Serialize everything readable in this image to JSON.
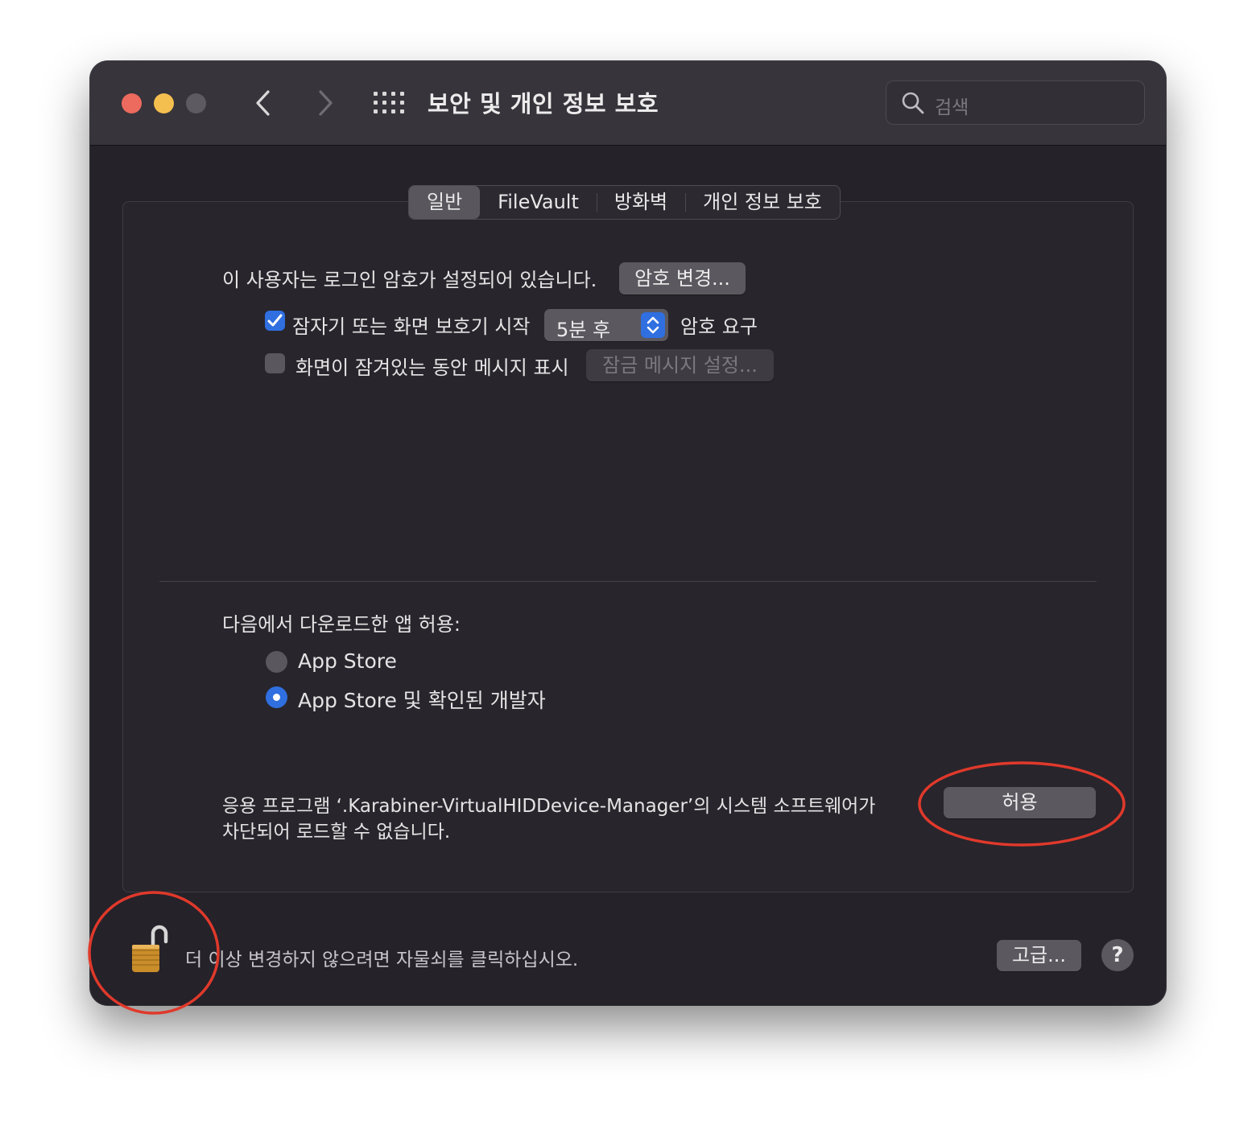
{
  "window": {
    "title": "보안 및 개인 정보 보호",
    "search_placeholder": "검색"
  },
  "tabs": [
    {
      "label": "일반",
      "active": true
    },
    {
      "label": "FileVault",
      "active": false
    },
    {
      "label": "방화벽",
      "active": false
    },
    {
      "label": "개인 정보 보호",
      "active": false
    }
  ],
  "general": {
    "password_set_text": "이 사용자는 로그인 암호가 설정되어 있습니다.",
    "change_password_button": "암호 변경...",
    "require_password": {
      "checked": true,
      "label": "잠자기 또는 화면 보호기 시작",
      "popup_value": "5분 후",
      "suffix": "암호 요구"
    },
    "show_message": {
      "checked": false,
      "label": "화면이 잠겨있는 동안 메시지 표시",
      "button": "잠금 메시지 설정..."
    }
  },
  "downloads": {
    "heading": "다음에서 다운로드한 앱 허용:",
    "options": [
      {
        "label": "App Store",
        "selected": false
      },
      {
        "label": "App Store 및 확인된 개발자",
        "selected": true
      }
    ]
  },
  "blocked": {
    "line1": "응용 프로그램 ‘.Karabiner-VirtualHIDDevice-Manager’의 시스템 소프트웨어가",
    "line2": "차단되어 로드할 수 없습니다.",
    "allow_button": "허용"
  },
  "footer": {
    "lock_text": "더 이상 변경하지 않으려면 자물쇠를 클릭하십시오.",
    "advanced_button": "고급...",
    "help_label": "?"
  },
  "colors": {
    "accent": "#2f6fe0",
    "annotation": "#e0392b",
    "window_bg": "#252229"
  },
  "icons": [
    "close-button",
    "minimize-button",
    "zoom-button",
    "back-chevron-icon",
    "forward-chevron-icon",
    "grid-icon",
    "search-icon",
    "checkmark-icon",
    "stepper-arrows-icon",
    "unlocked-padlock-icon"
  ]
}
